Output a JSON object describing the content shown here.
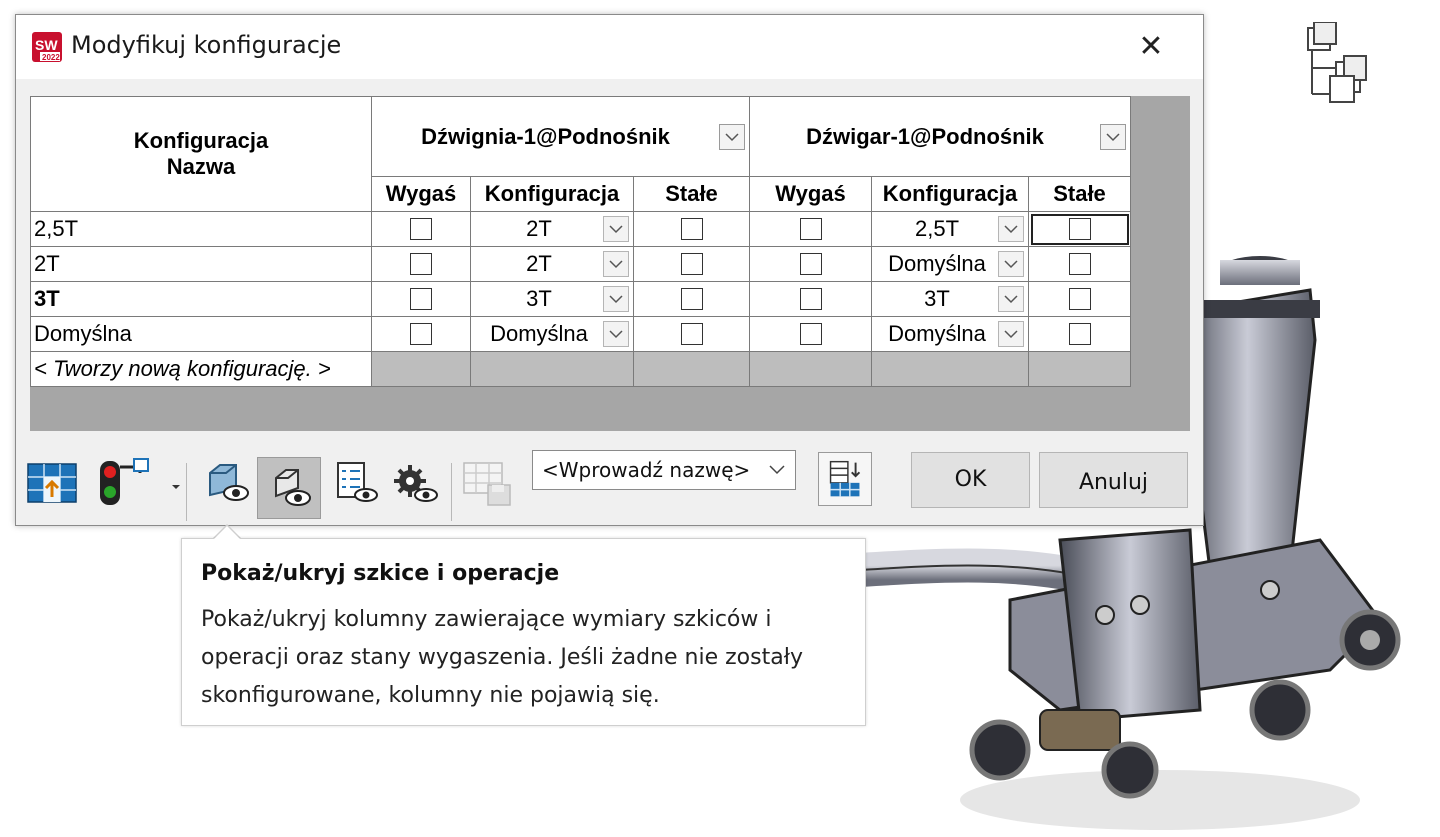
{
  "dialog": {
    "title": "Modyfikuj konfiguracje",
    "close_glyph": "✕",
    "app_icon": "solidworks-2022-icon"
  },
  "grid": {
    "name_header_line1": "Konfiguracja",
    "name_header_line2": "Nazwa",
    "components": [
      {
        "name": "Dźwignia-1@Podnośnik"
      },
      {
        "name": "Dźwigar-1@Podnośnik"
      }
    ],
    "sub_headers": {
      "suppress": "Wygaś",
      "configuration": "Konfiguracja",
      "fixed": "Stałe"
    },
    "rows": [
      {
        "name": "2,5T",
        "bold": false,
        "c1_cfg": "2T",
        "c2_cfg": "2,5T"
      },
      {
        "name": "2T",
        "bold": false,
        "c1_cfg": "2T",
        "c2_cfg": "Domyślna"
      },
      {
        "name": "3T",
        "bold": true,
        "c1_cfg": "3T",
        "c2_cfg": "3T"
      },
      {
        "name": "Domyślna",
        "bold": false,
        "c1_cfg": "Domyślna",
        "c2_cfg": "Domyślna"
      }
    ],
    "new_row": "< Tworzy nową konfigurację. >"
  },
  "toolbar": {
    "icons": [
      "apply-table-icon",
      "traffic-light-icon",
      "show-hide-features-icon",
      "show-hide-sketches-icon",
      "show-hide-custom-props-icon",
      "show-hide-config-params-icon",
      "save-table-icon"
    ],
    "name_combo": "<Wprowadź nazwę>",
    "ok": "OK",
    "cancel": "Anuluj"
  },
  "tooltip": {
    "title": "Pokaż/ukryj szkice i operacje",
    "body": "Pokaż/ukryj kolumny zawierające wymiary szkiców i operacji oraz stany wygaszenia. Jeśli żadne nie zostały skonfigurowane, kolumny nie pojawią się."
  },
  "colors": {
    "dialog_bg": "#f0f0f0",
    "grid_bg": "#a6a6a6",
    "grey_cell": "#bdbdbd",
    "selected_tool": "#c0c0c0"
  }
}
